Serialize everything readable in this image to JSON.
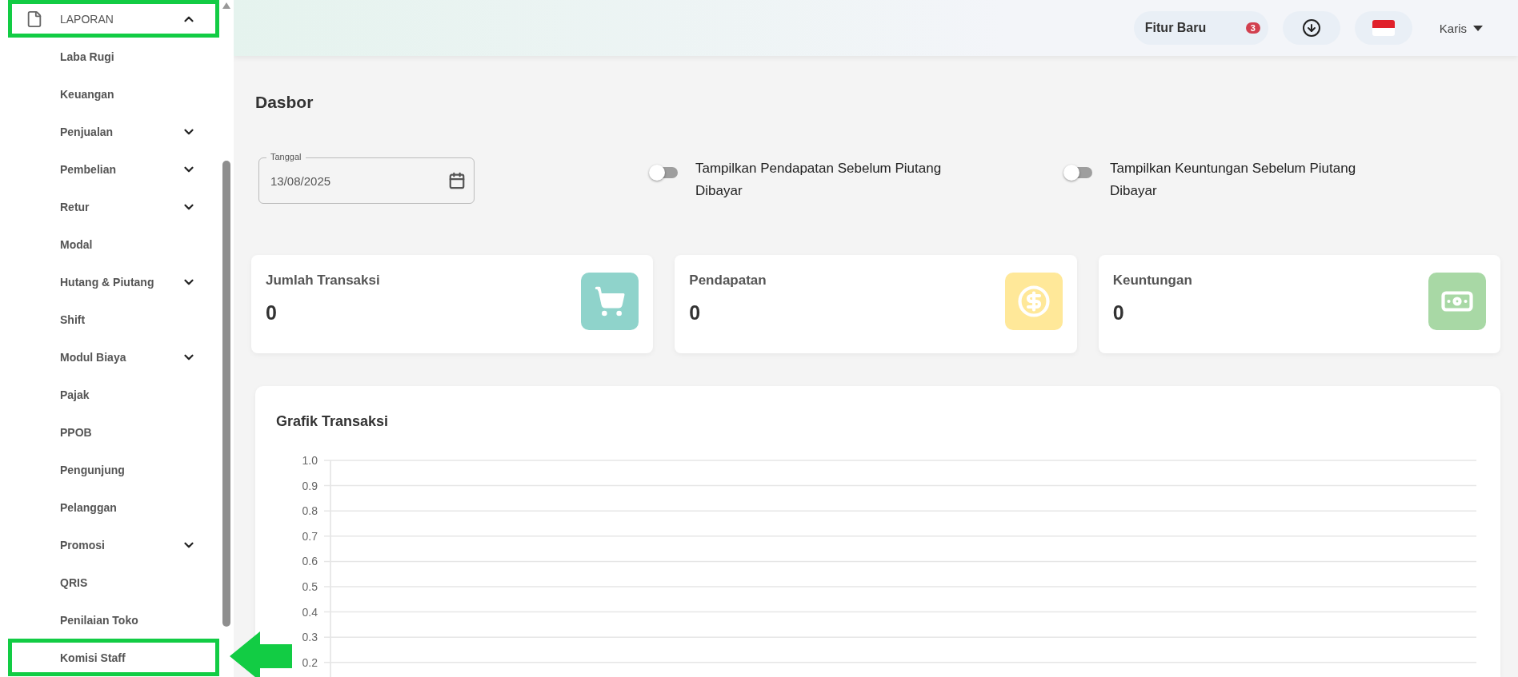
{
  "sidebar": {
    "section": {
      "label": "LAPORAN",
      "expanded": true,
      "highlighted": true
    },
    "items": [
      {
        "label": "Laba Rugi",
        "submenu": false,
        "highlighted": false,
        "arrow": false
      },
      {
        "label": "Keuangan",
        "submenu": false,
        "highlighted": false,
        "arrow": false
      },
      {
        "label": "Penjualan",
        "submenu": true,
        "highlighted": false,
        "arrow": false
      },
      {
        "label": "Pembelian",
        "submenu": true,
        "highlighted": false,
        "arrow": false
      },
      {
        "label": "Retur",
        "submenu": true,
        "highlighted": false,
        "arrow": false
      },
      {
        "label": "Modal",
        "submenu": false,
        "highlighted": false,
        "arrow": false
      },
      {
        "label": "Hutang & Piutang",
        "submenu": true,
        "highlighted": false,
        "arrow": false
      },
      {
        "label": "Shift",
        "submenu": false,
        "highlighted": false,
        "arrow": false
      },
      {
        "label": "Modul Biaya",
        "submenu": true,
        "highlighted": false,
        "arrow": false
      },
      {
        "label": "Pajak",
        "submenu": false,
        "highlighted": false,
        "arrow": false
      },
      {
        "label": "PPOB",
        "submenu": false,
        "highlighted": false,
        "arrow": false
      },
      {
        "label": "Pengunjung",
        "submenu": false,
        "highlighted": false,
        "arrow": false
      },
      {
        "label": "Pelanggan",
        "submenu": false,
        "highlighted": false,
        "arrow": false
      },
      {
        "label": "Promosi",
        "submenu": true,
        "highlighted": false,
        "arrow": false
      },
      {
        "label": "QRIS",
        "submenu": false,
        "highlighted": false,
        "arrow": false
      },
      {
        "label": "Penilaian Toko",
        "submenu": false,
        "highlighted": false,
        "arrow": false
      },
      {
        "label": "Komisi Staff",
        "submenu": false,
        "highlighted": true,
        "arrow": true
      }
    ]
  },
  "header": {
    "new_features": {
      "label": "Fitur Baru",
      "badge": "3"
    },
    "user": {
      "name": "Karis"
    }
  },
  "page_title": "Dasbor",
  "date_field": {
    "label": "Tanggal",
    "value": "13/08/2025"
  },
  "toggles": [
    {
      "label": "Tampilkan Pendapatan Sebelum Piutang Dibayar",
      "on": false
    },
    {
      "label": "Tampilkan Keuntungan Sebelum Piutang Dibayar",
      "on": false
    }
  ],
  "stat_cards": [
    {
      "title": "Jumlah Transaksi",
      "value": "0",
      "kind": "cart",
      "color": "#8fd3cb"
    },
    {
      "title": "Pendapatan",
      "value": "0",
      "kind": "coin",
      "color": "#ffe899"
    },
    {
      "title": "Keuntungan",
      "value": "0",
      "kind": "bill",
      "color": "#a8d8a5"
    }
  ],
  "chart": {
    "title": "Grafik Transaksi",
    "y_axis_labels": [
      "1.0",
      "0.9",
      "0.8",
      "0.7",
      "0.6",
      "0.5",
      "0.4",
      "0.3",
      "0.2"
    ]
  }
}
